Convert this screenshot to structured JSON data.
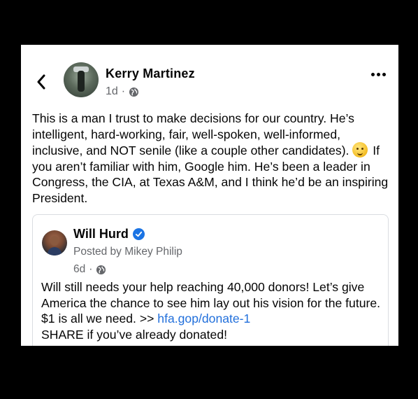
{
  "post": {
    "author": "Kerry Martinez",
    "time": "1d",
    "separator": "·",
    "body_main": "This is a man I trust to make decisions for our country. He’s intelligent, hard-working, fair, well-spoken, well-informed, inclusive, and NOT senile (like a couple other candidates).",
    "body_after_emoji": "If you aren’t familiar with him, Google him. He’s been a leader in Congress, the CIA, at Texas A&M, and I think he’d be an inspiring President."
  },
  "shared": {
    "author": "Will Hurd",
    "posted_by": "Posted by Mikey Philip",
    "time": "6d",
    "separator": "·",
    "text_before_link": "Will still needs your help reaching 40,000 donors! Let’s give America the chance to see him lay out his vision for the future. $1 is all we need. >>",
    "link": "hfa.gop/donate-1",
    "text_after_link": "SHARE if you’ve already donated!"
  },
  "icons": {
    "back": "chevron-left-icon",
    "more": "more-horizontal-icon",
    "privacy": "globe-icon",
    "verified": "verified-badge-icon",
    "emoji": "shushing-face-emoji"
  },
  "colors": {
    "link": "#216fdb",
    "verified": "#1b74e4",
    "meta": "#65676b"
  }
}
